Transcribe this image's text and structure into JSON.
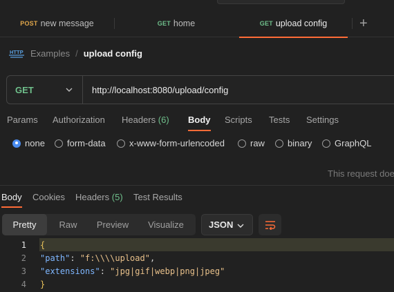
{
  "tabs": [
    {
      "method": "POST",
      "label": "new message"
    },
    {
      "method": "GET",
      "label": "home"
    },
    {
      "method": "GET",
      "label": "upload config"
    }
  ],
  "new_tab_symbol": "+",
  "breadcrumb": {
    "icon": "http-icon",
    "collection": "Examples",
    "separator": "/",
    "current": "upload config"
  },
  "request": {
    "method": "GET",
    "url": "http://localhost:8080/upload/config"
  },
  "request_tabs": {
    "params": "Params",
    "authorization": "Authorization",
    "headers": "Headers",
    "headers_count": "(6)",
    "body": "Body",
    "scripts": "Scripts",
    "tests": "Tests",
    "settings": "Settings"
  },
  "body_types": {
    "none": "none",
    "form_data": "form-data",
    "urlencoded": "x-www-form-urlencoded",
    "raw": "raw",
    "binary": "binary",
    "graphql": "GraphQL",
    "selected": "none"
  },
  "request_note": "This request doe",
  "response_tabs": {
    "body": "Body",
    "cookies": "Cookies",
    "headers": "Headers",
    "headers_count": "(5)",
    "test_results": "Test Results"
  },
  "format": {
    "pretty": "Pretty",
    "raw": "Raw",
    "preview": "Preview",
    "visualize": "Visualize",
    "language": "JSON"
  },
  "code": {
    "line_numbers": [
      "1",
      "2",
      "3",
      "4"
    ],
    "open_brace": "{",
    "close_brace": "}",
    "line2_key": "\"path\"",
    "line2_value": "\"f:\\\\\\\\upload\"",
    "line3_key": "\"extensions\"",
    "line3_value": "\"jpg|gif|webp|png|jpeg\""
  },
  "colors": {
    "accent": "#ff6c37",
    "get": "#6fbf8b",
    "post": "#e0a64a",
    "radio_selected": "#4a8cf0"
  }
}
